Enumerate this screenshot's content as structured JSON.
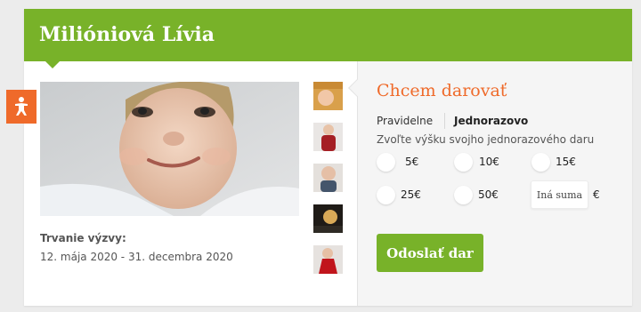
{
  "header": {
    "title": "Milióniová Lívia"
  },
  "badge": {
    "icon": "child-figure-icon",
    "color": "#ef6a2a"
  },
  "gallery": {
    "main_photo": "baby-face-photo",
    "thumbnails": [
      "thumb-photo-1",
      "thumb-photo-2",
      "thumb-photo-3",
      "thumb-photo-4",
      "thumb-photo-5"
    ]
  },
  "challenge": {
    "duration_label": "Trvanie výzvy:",
    "duration_value": "12. mája 2020 - 31. decembra 2020"
  },
  "donate": {
    "title": "Chcem darovať",
    "tabs": [
      {
        "label": "Pravidelne",
        "active": false
      },
      {
        "label": "Jednorazovo",
        "active": true
      }
    ],
    "choose_text": "Zvoľte výšku svojho jednorazového daru",
    "amounts": [
      "5€",
      "10€",
      "15€",
      "25€",
      "50€"
    ],
    "other_placeholder": "Iná suma",
    "currency": "€",
    "submit_label": "Odoslať dar"
  },
  "colors": {
    "brand_green": "#78b229",
    "accent_orange": "#ef6a2a",
    "page_bg": "#ececec",
    "panel_bg": "#f5f5f5"
  }
}
